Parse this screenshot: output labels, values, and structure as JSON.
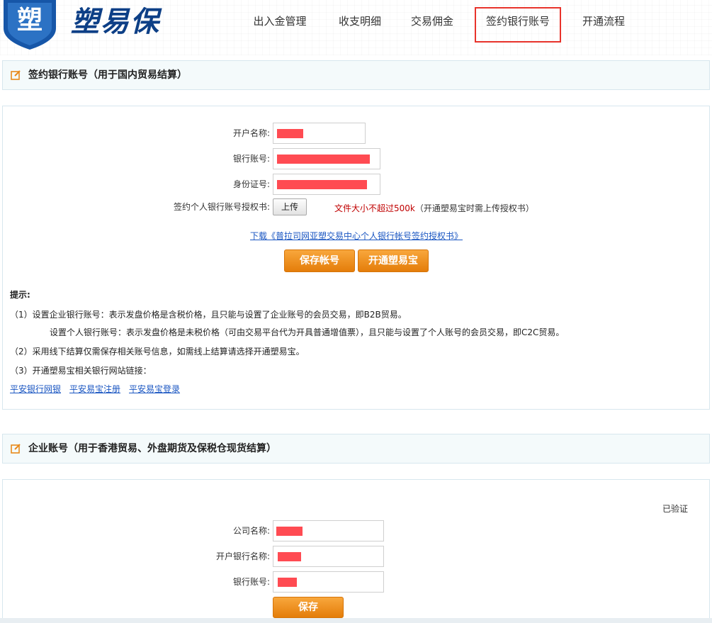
{
  "header": {
    "logo_char": "塑",
    "logo_text": "塑易保",
    "nav": [
      {
        "label": "出入金管理",
        "active": false
      },
      {
        "label": "收支明细",
        "active": false
      },
      {
        "label": "交易佣金",
        "active": false
      },
      {
        "label": "签约银行账号",
        "active": true
      },
      {
        "label": "开通流程",
        "active": false
      }
    ]
  },
  "section1": {
    "title": "签约银行账号（用于国内贸易结算）",
    "fields": {
      "account_name_label": "开户名称:",
      "bank_account_label": "银行账号:",
      "id_number_label": "身份证号:",
      "auth_letter_label": "签约个人银行账号授权书:"
    },
    "upload_label": "上传",
    "size_limit": "文件大小不超过500k",
    "size_note": "（开通塑易宝时需上传授权书）",
    "download_link": "下载《普拉司网亚塑交易中心个人银行帐号签约授权书》",
    "save_button": "保存帐号",
    "open_button": "开通塑易宝",
    "tips_title": "提示:",
    "tips": [
      "（1）设置企业银行账号：表示发盘价格是含税价格，且只能与设置了企业账号的会员交易，即B2B贸易。",
      "设置个人银行账号：表示发盘价格是未税价格（可由交易平台代为开具普通增值票），且只能与设置了个人账号的会员交易，即C2C贸易。",
      "（2）采用线下结算仅需保存相关账号信息，如需线上结算请选择开通塑易宝。",
      "（3）开通塑易宝相关银行网站链接："
    ],
    "bank_links": [
      "平安银行网银",
      "平安易宝注册",
      "平安易宝登录"
    ]
  },
  "section2": {
    "title": "企业账号（用于香港贸易、外盘期货及保税仓现货结算）",
    "verified": "已验证",
    "fields": {
      "company_name_label": "公司名称:",
      "bank_name_label": "开户银行名称:",
      "bank_account_label": "银行账号:"
    },
    "save_button": "保存"
  },
  "colors": {
    "brand_blue": "#0d3f86",
    "orange_button": "#f29a2e",
    "redacted": "#ff4b52",
    "active_nav_border": "#e8332b"
  }
}
